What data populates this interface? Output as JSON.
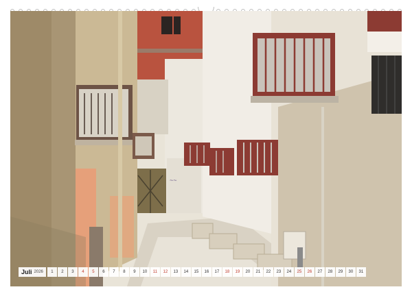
{
  "calendar": {
    "month": "Juli",
    "year": "2026",
    "days": [
      "1",
      "2",
      "3",
      "4",
      "5",
      "6",
      "7",
      "8",
      "9",
      "10",
      "11",
      "12",
      "13",
      "14",
      "15",
      "16",
      "17",
      "18",
      "19",
      "20",
      "21",
      "22",
      "23",
      "24",
      "25",
      "26",
      "27",
      "28",
      "29",
      "30",
      "31"
    ],
    "weekend": [
      4,
      5,
      11,
      12,
      18,
      19,
      25,
      26
    ],
    "weekend_color": "#c0392b"
  },
  "photo": {
    "subject": "narrow alley with old whitewashed houses and air-conditioner cages"
  }
}
